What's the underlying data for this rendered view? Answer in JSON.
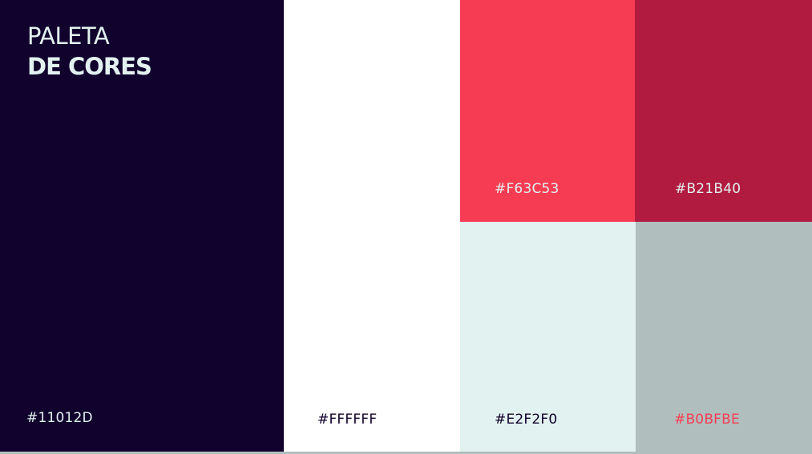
{
  "title": {
    "line1": "PALETA",
    "line2": "DE CORES"
  },
  "swatches": [
    {
      "id": "dark",
      "hex": "#11012D",
      "label": "#11012D",
      "label_color": "#E2F2F0"
    },
    {
      "id": "white",
      "hex": "#FFFFFF",
      "label": "#FFFFFF",
      "label_color": "#11012D"
    },
    {
      "id": "coral",
      "hex": "#F63C53",
      "label": "#F63C53",
      "label_color": "#E2F2F0"
    },
    {
      "id": "crimson",
      "hex": "#B21B40",
      "label": "#B21B40",
      "label_color": "#E2F2F0"
    },
    {
      "id": "mint",
      "hex": "#E2F2F0",
      "label": "#E2F2F0",
      "label_color": "#11012D"
    },
    {
      "id": "gray",
      "hex": "#B0BFBE",
      "label": "#B0BFBE",
      "label_color": "#F63C53"
    }
  ]
}
